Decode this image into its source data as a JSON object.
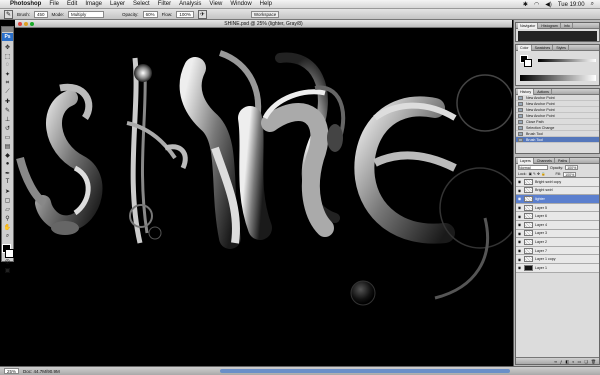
{
  "menubar": {
    "app": "Photoshop",
    "items": [
      "File",
      "Edit",
      "Image",
      "Layer",
      "Select",
      "Filter",
      "Analysis",
      "View",
      "Window",
      "Help"
    ],
    "clock": "Tue 19:00"
  },
  "options": {
    "brush_label": "Brush:",
    "brush_size": "450",
    "mode_label": "Mode:",
    "mode_value": "Multiply",
    "opacity_label": "Opacity:",
    "opacity_value": "60%",
    "flow_label": "Flow:",
    "flow_value": "100%",
    "workspace": "Workspace"
  },
  "document": {
    "title": "SHINE.psd @ 25% (lighter, Gray/8)",
    "status_zoom": "25%",
    "status_doc": "Doc: 44.7M/90.9M"
  },
  "navigator": {
    "tabs": [
      "Navigator",
      "Histogram",
      "Info"
    ]
  },
  "color": {
    "tabs": [
      "Color",
      "Swatches",
      "Styles"
    ]
  },
  "history": {
    "tabs": [
      "History",
      "Actions"
    ],
    "rows": [
      "New Anchor Point",
      "New Anchor Point",
      "New Anchor Point",
      "New Anchor Point",
      "Close Path",
      "Selection Change",
      "Brush Tool",
      "Brush Tool"
    ],
    "selected_index": 7
  },
  "layers": {
    "tabs": [
      "Layers",
      "Channels",
      "Paths"
    ],
    "blend_mode": "Normal",
    "opacity_label": "Opacity:",
    "opacity_value": "100%",
    "lock_label": "Lock:",
    "fill_label": "Fill:",
    "fill_value": "100%",
    "rows": [
      {
        "name": "Bright swirl copy",
        "dark": false
      },
      {
        "name": "Bright swirl",
        "dark": false
      },
      {
        "name": "lighter",
        "dark": false
      },
      {
        "name": "Layer 5",
        "dark": false
      },
      {
        "name": "Layer 6",
        "dark": false
      },
      {
        "name": "Layer 4",
        "dark": false
      },
      {
        "name": "Layer 3",
        "dark": false
      },
      {
        "name": "Layer 2",
        "dark": false
      },
      {
        "name": "Layer 7",
        "dark": false
      },
      {
        "name": "Layer 1 copy",
        "dark": false
      },
      {
        "name": "Layer 1",
        "dark": true
      }
    ],
    "selected_index": 2
  },
  "colors": {
    "accent": "#5b7fce",
    "canvas": "#000000",
    "ps_logo": "#2a6fc9"
  }
}
